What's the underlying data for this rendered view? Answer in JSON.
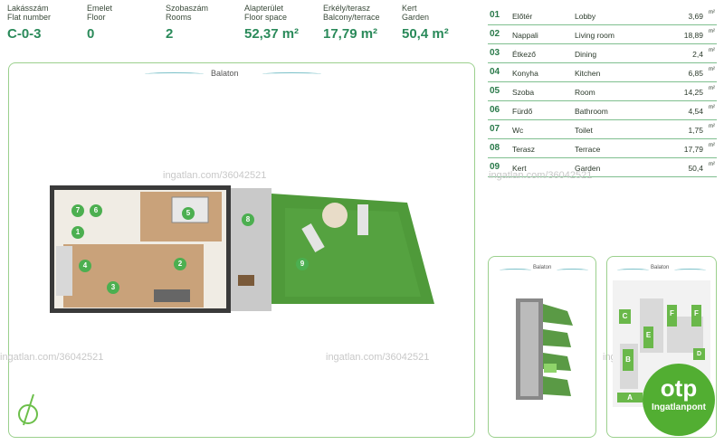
{
  "header": [
    {
      "hu": "Lakásszám",
      "en": "Flat number",
      "value": "C-0-3"
    },
    {
      "hu": "Emelet",
      "en": "Floor",
      "value": "0"
    },
    {
      "hu": "Szobaszám",
      "en": "Rooms",
      "value": "2"
    },
    {
      "hu": "Alapterület",
      "en": "Floor space",
      "value": "52,37 m²"
    },
    {
      "hu": "Erkély/terasz",
      "en": "Balcony/terrace",
      "value": "17,79 m²"
    },
    {
      "hu": "Kert",
      "en": "Garden",
      "value": "50,4 m²"
    }
  ],
  "rooms": [
    {
      "no": "01",
      "hu": "Előtér",
      "en": "Lobby",
      "area": "3,69",
      "unit": "m²"
    },
    {
      "no": "02",
      "hu": "Nappali",
      "en": "Living room",
      "area": "18,89",
      "unit": "m²"
    },
    {
      "no": "03",
      "hu": "Étkező",
      "en": "Dining",
      "area": "2,4",
      "unit": "m²"
    },
    {
      "no": "04",
      "hu": "Konyha",
      "en": "Kitchen",
      "area": "6,85",
      "unit": "m²"
    },
    {
      "no": "05",
      "hu": "Szoba",
      "en": "Room",
      "area": "14,25",
      "unit": "m²"
    },
    {
      "no": "06",
      "hu": "Fürdő",
      "en": "Bathroom",
      "area": "4,54",
      "unit": "m²"
    },
    {
      "no": "07",
      "hu": "Wc",
      "en": "Toilet",
      "area": "1,75",
      "unit": "m²"
    },
    {
      "no": "08",
      "hu": "Terasz",
      "en": "Terrace",
      "area": "17,79",
      "unit": "m²"
    },
    {
      "no": "09",
      "hu": "Kert",
      "en": "Garden",
      "area": "50,4",
      "unit": "m²"
    }
  ],
  "lake_label": "Balaton",
  "watermark": "ingatlan.com/36042521",
  "plan_numbers": [
    "1",
    "2",
    "3",
    "4",
    "5",
    "6",
    "7",
    "8",
    "9"
  ],
  "site_letters": [
    "A",
    "B",
    "C",
    "D",
    "E",
    "F"
  ],
  "logo": {
    "line1": "otp",
    "line2": "Ingatlanpont"
  },
  "colors": {
    "accent": "#2a8a5a",
    "frame": "#9bd08d",
    "garden": "#4f9a3a",
    "logo": "#52ae32"
  }
}
